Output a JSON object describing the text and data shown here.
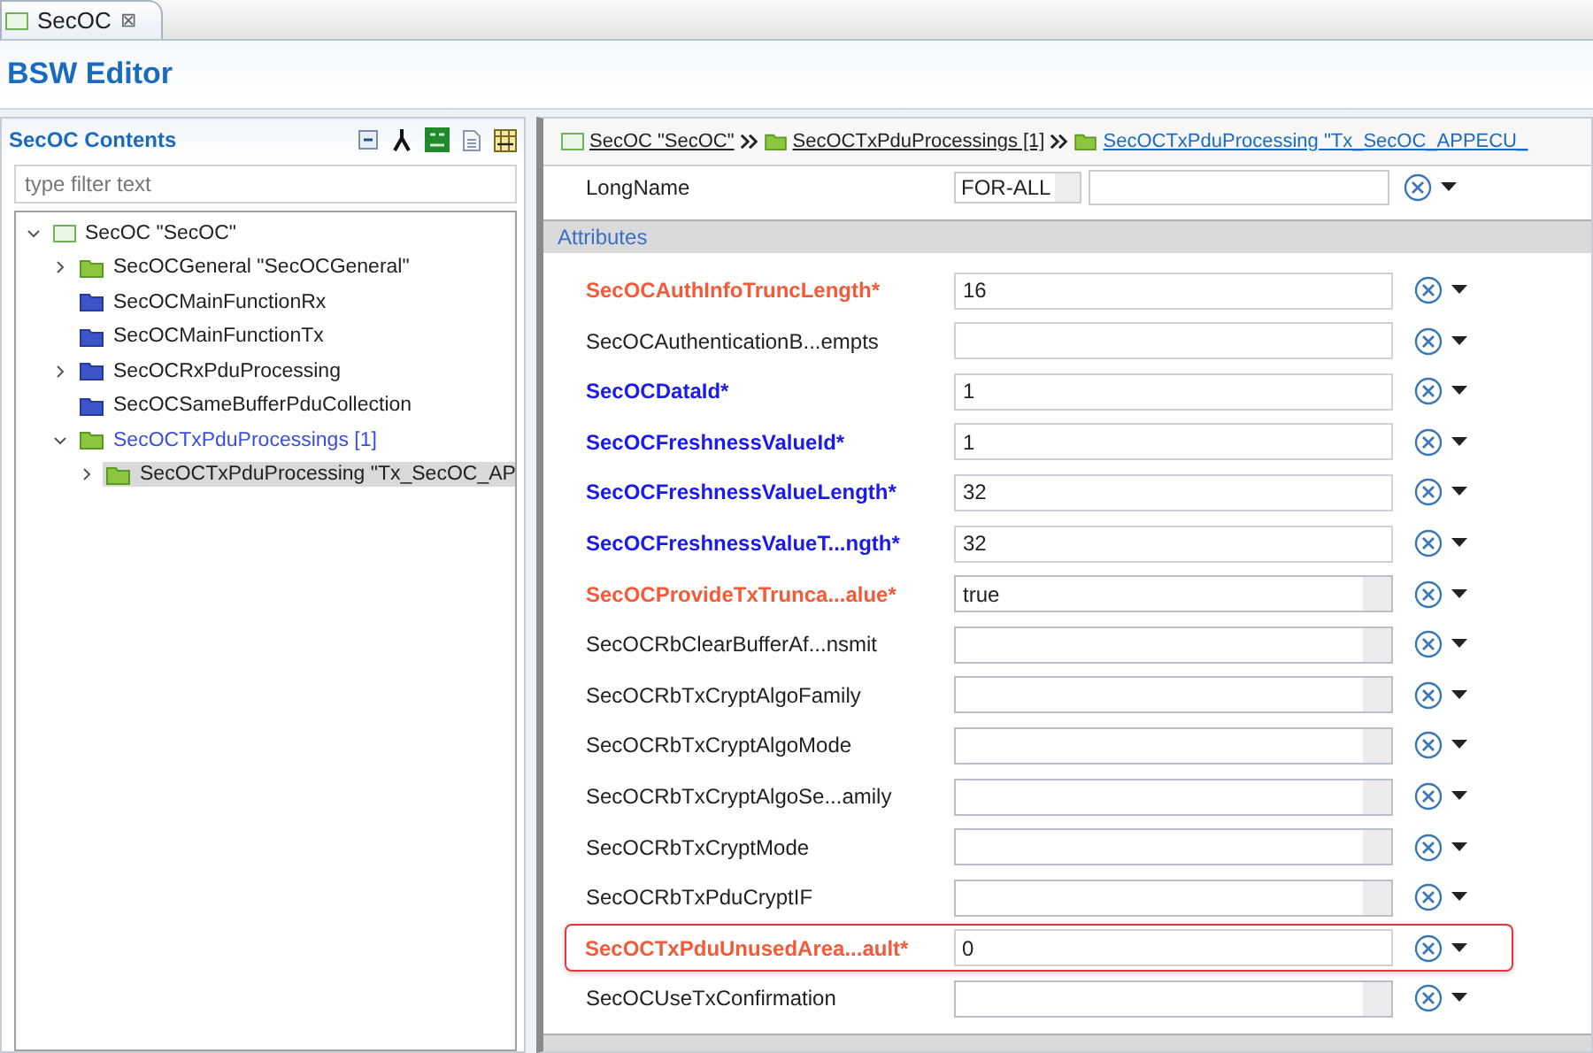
{
  "editor_tab": {
    "title": "SecOC",
    "close": "⊠"
  },
  "header": {
    "title": "BSW Editor"
  },
  "contents": {
    "title": "SecOC Contents",
    "filter": {
      "placeholder": "type filter text"
    },
    "tree": [
      {
        "label": "SecOC \"SecOC\"",
        "kind": "module",
        "expanded": true,
        "selected": false,
        "children": [
          {
            "label": "SecOCGeneral \"SecOCGeneral\"",
            "kind": "green",
            "expanded": false,
            "selected": false
          },
          {
            "label": "SecOCMainFunctionRx",
            "kind": "blue",
            "selected": false
          },
          {
            "label": "SecOCMainFunctionTx",
            "kind": "blue",
            "selected": false
          },
          {
            "label": "SecOCRxPduProcessing",
            "kind": "blue",
            "expanded": false,
            "selected": false
          },
          {
            "label": "SecOCSameBufferPduCollection",
            "kind": "blue",
            "selected": false
          },
          {
            "label": "SecOCTxPduProcessings [1]",
            "kind": "green",
            "color": "#3a4fe0",
            "expanded": true,
            "selected": false,
            "children": [
              {
                "label": "SecOCTxPduProcessing \"Tx_SecOC_AP",
                "kind": "green",
                "expanded": false,
                "selected": true
              }
            ]
          }
        ]
      }
    ]
  },
  "breadcrumb": [
    {
      "label": "SecOC \"SecOC\"",
      "kind": "module",
      "current": false
    },
    {
      "label": "SecOCTxPduProcessings [1]",
      "kind": "folder",
      "current": false
    },
    {
      "label": "SecOCTxPduProcessing \"Tx_SecOC_APPECU_",
      "kind": "folder",
      "current": true
    }
  ],
  "longname": {
    "label": "LongName",
    "language": "FOR-ALL"
  },
  "attributes": {
    "title": "Attributes",
    "rows": [
      {
        "label": "SecOCAuthInfoTruncLength*",
        "color": "#f25a38",
        "bold": true,
        "kind": "text",
        "value": "16",
        "highlighted": false
      },
      {
        "label": "SecOCAuthenticationB...empts",
        "color": "#222222",
        "bold": false,
        "kind": "text",
        "value": "",
        "highlighted": false
      },
      {
        "label": "SecOCDataId*",
        "color": "#1a1aee",
        "bold": true,
        "kind": "text",
        "value": "1",
        "highlighted": false
      },
      {
        "label": "SecOCFreshnessValueId*",
        "color": "#1a1aee",
        "bold": true,
        "kind": "text",
        "value": "1",
        "highlighted": false
      },
      {
        "label": "SecOCFreshnessValueLength*",
        "color": "#1a1aee",
        "bold": true,
        "kind": "text",
        "value": "32",
        "highlighted": false
      },
      {
        "label": "SecOCFreshnessValueT...ngth*",
        "color": "#1a1aee",
        "bold": true,
        "kind": "text",
        "value": "32",
        "highlighted": false
      },
      {
        "label": "SecOCProvideTxTrunca...alue*",
        "color": "#f25a38",
        "bold": true,
        "kind": "combo",
        "value": "true",
        "highlighted": false
      },
      {
        "label": "SecOCRbClearBufferAf...nsmit",
        "color": "#222222",
        "bold": false,
        "kind": "combo",
        "value": "",
        "highlighted": false
      },
      {
        "label": "SecOCRbTxCryptAlgoFamily",
        "color": "#222222",
        "bold": false,
        "kind": "combo",
        "value": "",
        "highlighted": false
      },
      {
        "label": "SecOCRbTxCryptAlgoMode",
        "color": "#222222",
        "bold": false,
        "kind": "combo",
        "value": "",
        "highlighted": false
      },
      {
        "label": "SecOCRbTxCryptAlgoSe...amily",
        "color": "#222222",
        "bold": false,
        "kind": "combo",
        "value": "",
        "highlighted": false
      },
      {
        "label": "SecOCRbTxCryptMode",
        "color": "#222222",
        "bold": false,
        "kind": "combo",
        "value": "",
        "highlighted": false
      },
      {
        "label": "SecOCRbTxPduCryptIF",
        "color": "#222222",
        "bold": false,
        "kind": "combo",
        "value": "",
        "highlighted": false
      },
      {
        "label": "SecOCTxPduUnusedArea...ault*",
        "color": "#f25a38",
        "bold": true,
        "kind": "text",
        "value": "0",
        "highlighted": true
      },
      {
        "label": "SecOCUseTxConfirmation",
        "color": "#222222",
        "bold": false,
        "kind": "combo",
        "value": "",
        "highlighted": false
      }
    ]
  }
}
